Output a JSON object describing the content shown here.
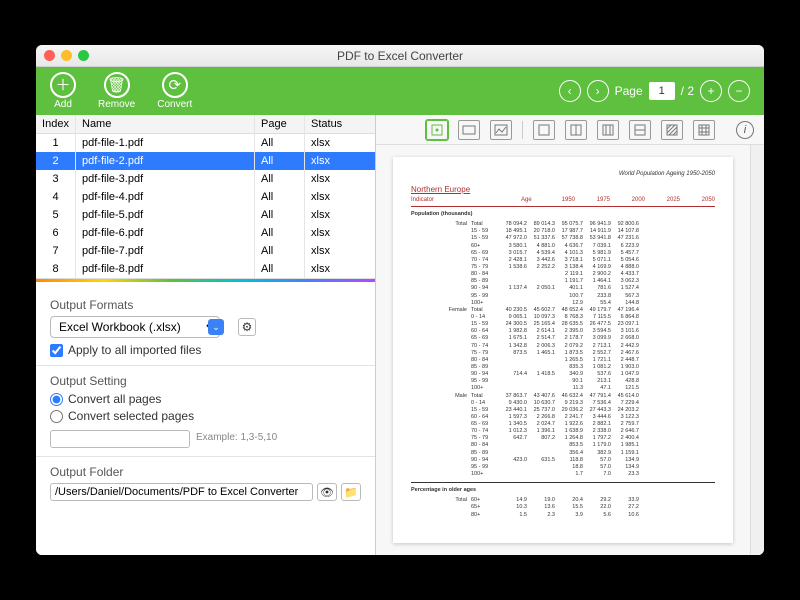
{
  "window": {
    "title": "PDF to Excel Converter"
  },
  "toolbar": {
    "add": "Add",
    "remove": "Remove",
    "convert": "Convert",
    "page_label": "Page",
    "page_current": "1",
    "page_total": "/ 2"
  },
  "table": {
    "headers": {
      "index": "Index",
      "name": "Name",
      "page": "Page",
      "status": "Status"
    },
    "rows": [
      {
        "idx": "1",
        "name": "pdf-file-1.pdf",
        "page": "All",
        "status": "xlsx",
        "sel": false
      },
      {
        "idx": "2",
        "name": "pdf-file-2.pdf",
        "page": "All",
        "status": "xlsx",
        "sel": true
      },
      {
        "idx": "3",
        "name": "pdf-file-3.pdf",
        "page": "All",
        "status": "xlsx",
        "sel": false
      },
      {
        "idx": "4",
        "name": "pdf-file-4.pdf",
        "page": "All",
        "status": "xlsx",
        "sel": false
      },
      {
        "idx": "5",
        "name": "pdf-file-5.pdf",
        "page": "All",
        "status": "xlsx",
        "sel": false
      },
      {
        "idx": "6",
        "name": "pdf-file-6.pdf",
        "page": "All",
        "status": "xlsx",
        "sel": false
      },
      {
        "idx": "7",
        "name": "pdf-file-7.pdf",
        "page": "All",
        "status": "xlsx",
        "sel": false
      },
      {
        "idx": "8",
        "name": "pdf-file-8.pdf",
        "page": "All",
        "status": "xlsx",
        "sel": false
      }
    ]
  },
  "settings": {
    "formats_label": "Output Formats",
    "format_value": "Excel Workbook (.xlsx)",
    "apply_all": "Apply to all imported files",
    "output_setting": "Output Setting",
    "opt_all": "Convert all pages",
    "opt_sel": "Convert selected pages",
    "example": "Example: 1,3-5,10",
    "folder_label": "Output Folder",
    "folder_value": "/Users/Daniel/Documents/PDF to Excel Converter"
  },
  "preview": {
    "doc_header": "World Population Ageing 1950-2050",
    "region": "Northern Europe",
    "indicator": "Indicator",
    "age_h": "Age",
    "years": [
      "1950",
      "1975",
      "2000",
      "2025",
      "2050"
    ],
    "section1": "Population (thousands)",
    "section2": "Percentage in older ages",
    "groups": [
      {
        "label": "Total",
        "rows": [
          {
            "age": "Total",
            "v": [
              "78 094.2",
              "89 014.3",
              "95 075.7",
              "96 941.9",
              "92 800.6"
            ]
          },
          {
            "age": "15 - 59",
            "v": [
              "18 495.1",
              "20 718.0",
              "17 987.7",
              "14 911.9",
              "14 107.8"
            ]
          },
          {
            "age": "15 - 59",
            "v": [
              "47 972.0",
              "51 337.6",
              "57 738.8",
              "53 941.8",
              "47 231.6"
            ]
          },
          {
            "age": "60+",
            "v": [
              "3 580.1",
              "4 881.0",
              "4 636.7",
              "7 039.1",
              "6 223.9"
            ]
          },
          {
            "age": "65 - 69",
            "v": [
              "3 015.7",
              "4 539.4",
              "4 101.3",
              "5 981.9",
              "5 457.7"
            ]
          },
          {
            "age": "70 - 74",
            "v": [
              "2 428.1",
              "3 442.6",
              "3 718.1",
              "5 071.1",
              "5 054.6"
            ]
          },
          {
            "age": "75 - 79",
            "v": [
              "1 538.6",
              "2 252.2",
              "3 138.4",
              "4 169.9",
              "4 888.0"
            ]
          },
          {
            "age": "80 - 84",
            "v": [
              "",
              "",
              "2 119.1",
              "2 900.2",
              "4 433.7"
            ]
          },
          {
            "age": "85 - 89",
            "v": [
              "",
              "",
              "1 191.7",
              "1 464.1",
              "3 062.3"
            ]
          },
          {
            "age": "90 - 94",
            "v": [
              "1 137.4",
              "2 050.1",
              "401.1",
              "781.6",
              "1 527.4"
            ]
          },
          {
            "age": "95 - 99",
            "v": [
              "",
              "",
              "100.7",
              "233.8",
              "567.3"
            ]
          },
          {
            "age": "100+",
            "v": [
              "",
              "",
              "12.9",
              "55.4",
              "144.8"
            ]
          }
        ]
      },
      {
        "label": "Female",
        "rows": [
          {
            "age": "Total",
            "v": [
              "40 230.5",
              "45 602.7",
              "48 652.4",
              "49 179.7",
              "47 196.4"
            ]
          },
          {
            "age": "0 - 14",
            "v": [
              "9 065.1",
              "10 097.3",
              "8 768.3",
              "7 115.5",
              "6 864.8"
            ]
          },
          {
            "age": "15 - 59",
            "v": [
              "24 300.5",
              "25 165.4",
              "28 635.5",
              "26 477.5",
              "23 097.1"
            ]
          },
          {
            "age": "60 - 64",
            "v": [
              "1 982.8",
              "2 614.1",
              "2 395.0",
              "3 594.5",
              "3 101.6"
            ]
          },
          {
            "age": "65 - 69",
            "v": [
              "1 675.1",
              "2 514.7",
              "2 178.7",
              "3 099.9",
              "2 668.0"
            ]
          },
          {
            "age": "70 - 74",
            "v": [
              "1 342.8",
              "2 006.3",
              "2 079.2",
              "2 713.1",
              "2 442.9"
            ]
          },
          {
            "age": "75 - 79",
            "v": [
              "873.5",
              "1 465.1",
              "1 873.5",
              "2 552.7",
              "2 467.6"
            ]
          },
          {
            "age": "80 - 84",
            "v": [
              "",
              "",
              "1 265.5",
              "1 721.1",
              "2 448.7"
            ]
          },
          {
            "age": "85 - 89",
            "v": [
              "",
              "",
              "835.3",
              "1 081.2",
              "1 903.0"
            ]
          },
          {
            "age": "90 - 94",
            "v": [
              "714.4",
              "1 418.5",
              "340.9",
              "537.6",
              "1 047.9"
            ]
          },
          {
            "age": "95 - 99",
            "v": [
              "",
              "",
              "90.1",
              "213.1",
              "428.8"
            ]
          },
          {
            "age": "100+",
            "v": [
              "",
              "",
              "11.3",
              "47.1",
              "121.5"
            ]
          }
        ]
      },
      {
        "label": "Male",
        "rows": [
          {
            "age": "Total",
            "v": [
              "37 863.7",
              "43 407.6",
              "46 632.4",
              "47 791.4",
              "45 614.0"
            ]
          },
          {
            "age": "0 - 14",
            "v": [
              "9 430.0",
              "10 630.7",
              "9 219.3",
              "7 536.4",
              "7 229.4"
            ]
          },
          {
            "age": "15 - 59",
            "v": [
              "23 440.1",
              "25 737.0",
              "29 036.2",
              "27 443.3",
              "24 203.2"
            ]
          },
          {
            "age": "60 - 64",
            "v": [
              "1 597.3",
              "2 266.8",
              "2 241.7",
              "3 444.6",
              "3 122.3"
            ]
          },
          {
            "age": "65 - 69",
            "v": [
              "1 340.5",
              "2 024.7",
              "1 922.6",
              "2 882.1",
              "2 759.7"
            ]
          },
          {
            "age": "70 - 74",
            "v": [
              "1 012.3",
              "1 396.1",
              "1 638.9",
              "2 338.0",
              "2 646.7"
            ]
          },
          {
            "age": "75 - 79",
            "v": [
              "642.7",
              "807.2",
              "1 264.8",
              "1 797.2",
              "2 400.4"
            ]
          },
          {
            "age": "80 - 84",
            "v": [
              "",
              "",
              "853.5",
              "1 179.0",
              "1 985.1"
            ]
          },
          {
            "age": "85 - 89",
            "v": [
              "",
              "",
              "356.4",
              "382.9",
              "1 159.1"
            ]
          },
          {
            "age": "90 - 94",
            "v": [
              "423.0",
              "631.5",
              "118.8",
              "57.0",
              "134.9"
            ]
          },
          {
            "age": "95 - 99",
            "v": [
              "",
              "",
              "18.8",
              "57.0",
              "134.9"
            ]
          },
          {
            "age": "100+",
            "v": [
              "",
              "",
              "1.7",
              "7.0",
              "23.3"
            ]
          }
        ]
      }
    ],
    "pct_rows": [
      {
        "label": "Total",
        "age": "60+",
        "v": [
          "14.9",
          "19.0",
          "20.4",
          "29.2",
          "33.9"
        ]
      },
      {
        "label": "",
        "age": "65+",
        "v": [
          "10.3",
          "13.6",
          "15.5",
          "22.0",
          "27.2"
        ]
      },
      {
        "label": "",
        "age": "80+",
        "v": [
          "1.5",
          "2.3",
          "3.9",
          "5.6",
          "10.6"
        ]
      }
    ]
  }
}
